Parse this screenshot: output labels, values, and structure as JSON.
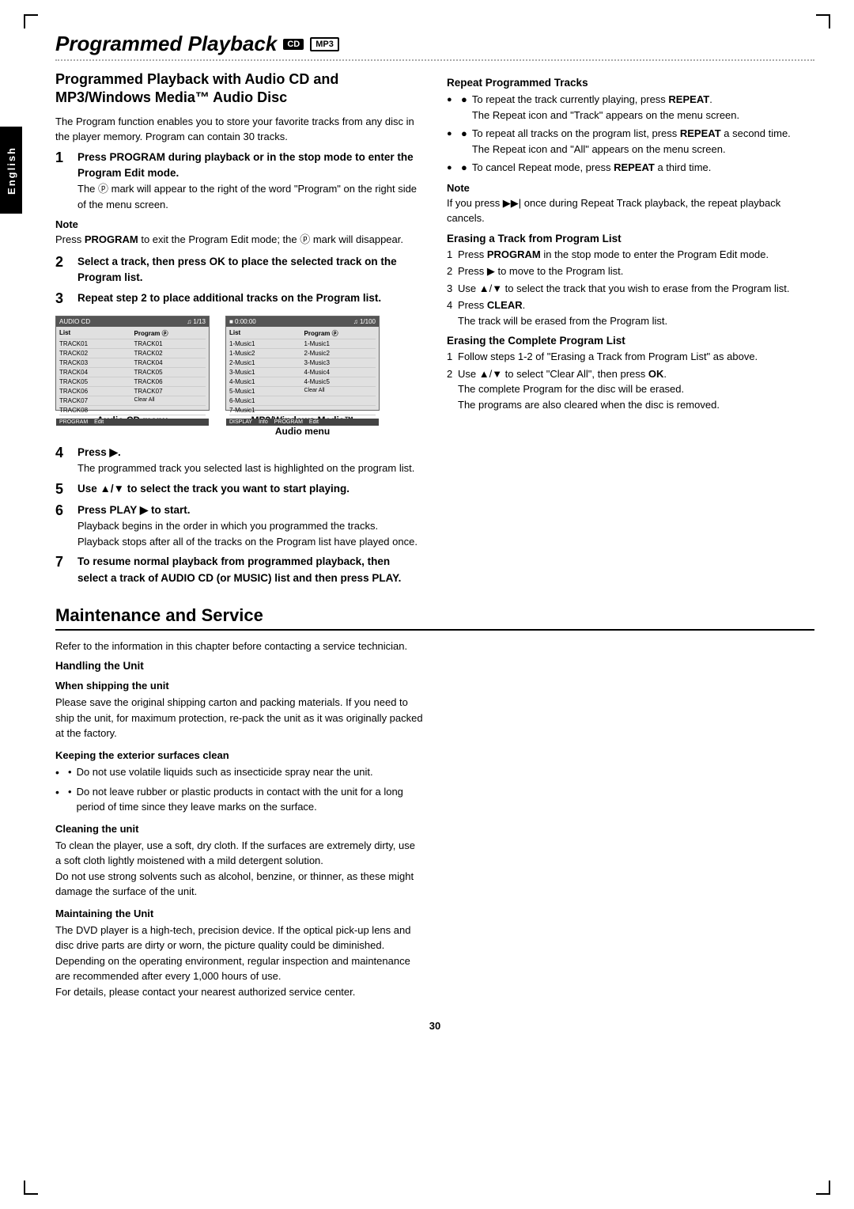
{
  "page": {
    "number": "30",
    "corners": [
      "tl",
      "tr",
      "bl",
      "br"
    ]
  },
  "english_tab": "English",
  "main_title": {
    "text": "Programmed Playback",
    "badge1": "CD",
    "badge2": "MP3"
  },
  "left_section": {
    "heading": "Programmed Playback with Audio CD and MP3/Windows Media™ Audio Disc",
    "intro": "The Program function enables you to store your favorite tracks from any disc in the player memory. Program can contain 30 tracks.",
    "step1": {
      "num": "1",
      "title": "Press PROGRAM during playback or in the stop mode to enter the Program Edit mode.",
      "body": "The ⓟ mark will appear to the right of the word \"Program\" on the right side of the menu screen."
    },
    "note1": {
      "title": "Note",
      "text": "Press PROGRAM to exit the Program Edit mode; the ⓟ mark will disappear."
    },
    "step2": {
      "num": "2",
      "title": "Select a track, then press OK to place the selected track on the Program list."
    },
    "step3": {
      "num": "3",
      "title": "Repeat step 2 to place additional tracks on the Program list."
    },
    "screen1_caption": "Audio CD menu",
    "screen2_caption": "MP3/Windows Media™",
    "screen2_caption2": "Audio menu",
    "step4": {
      "num": "4",
      "title": "Press ▶.",
      "body": "The programmed track you selected last is highlighted on the program list."
    },
    "step5": {
      "num": "5",
      "title": "Use ▲/▼ to select the track you want to start playing."
    },
    "step6": {
      "num": "6",
      "title": "Press PLAY ▶ to start.",
      "body": "Playback begins in the order in which you programmed the tracks.\nPlayback stops after all of the tracks on the Program list have played once."
    },
    "step7": {
      "num": "7",
      "title": "To resume normal playback from programmed playback, then select a track of AUDIO CD (or MUSIC) list and then press PLAY."
    }
  },
  "right_section": {
    "repeat_title": "Repeat Programmed Tracks",
    "repeat_bullets": [
      {
        "text_before": "To repeat the track currently playing, press ",
        "bold": "REPEAT",
        "text_after": ".",
        "sub": "The Repeat icon and \"Track\" appears on the menu screen."
      },
      {
        "text_before": "To repeat all tracks on the program list, press ",
        "bold": "REPEAT",
        "text_after": " a second time.",
        "sub": "The Repeat icon and \"All\" appears on the menu screen."
      },
      {
        "text_before": "To cancel Repeat mode, press ",
        "bold": "REPEAT",
        "text_after": " a third time."
      }
    ],
    "note2": {
      "title": "Note",
      "text": "If you press ▶▶| once during Repeat Track playback, the repeat playback cancels."
    },
    "erase_track_title": "Erasing a Track from Program List",
    "erase_track_steps": [
      {
        "num": "1",
        "text": "Press PROGRAM in the stop mode to enter the Program Edit  mode."
      },
      {
        "num": "2",
        "text": "Press ▶ to move to the Program list."
      },
      {
        "num": "3",
        "text": "Use ▲/▼ to select the track that you wish to erase from the Program list."
      },
      {
        "num": "4",
        "text_before": "Press ",
        "bold": "CLEAR",
        "text_after": ".",
        "sub": "The track will be erased from the Program list."
      }
    ],
    "erase_program_title": "Erasing the Complete Program List",
    "erase_program_steps": [
      {
        "num": "1",
        "text": "Follow steps 1-2 of \"Erasing a Track from Program List\" as above."
      },
      {
        "num": "2",
        "text_before": "Use ▲/▼ to select \"Clear All\", then press ",
        "bold": "OK",
        "text_after": ".",
        "sub1": "The complete Program for the disc will be erased.",
        "sub2": "The programs are also cleared when the disc is removed."
      }
    ]
  },
  "maintenance": {
    "title": "Maintenance and Service",
    "intro": "Refer to the information in this chapter before contacting a service technician.",
    "handling_title": "Handling the Unit",
    "shipping_title": "When shipping the unit",
    "shipping_text": "Please save the original shipping carton and packing materials. If you need to ship the unit, for maximum protection, re-pack the unit as it was originally packed at the factory.",
    "exterior_title": "Keeping the exterior surfaces clean",
    "exterior_bullets": [
      "Do not use volatile liquids such as insecticide spray near the unit.",
      "Do not leave rubber or plastic products in contact with the unit for a long period of time since they leave marks on the surface."
    ],
    "cleaning_title": "Cleaning the unit",
    "cleaning_text": "To clean the player, use a soft, dry cloth. If the surfaces are extremely dirty, use a soft cloth lightly moistened with a mild detergent solution.\nDo not use strong solvents such as alcohol, benzine, or thinner, as these might damage the surface of the unit.",
    "maintaining_title": "Maintaining the Unit",
    "maintaining_text": "The DVD player is a high-tech, precision device. If the optical pick-up lens and disc drive parts are dirty or worn, the picture quality could be diminished.\nDepending on the operating environment, regular inspection and maintenance are recommended after every 1,000 hours of use.\nFor details, please contact your nearest authorized service center."
  }
}
